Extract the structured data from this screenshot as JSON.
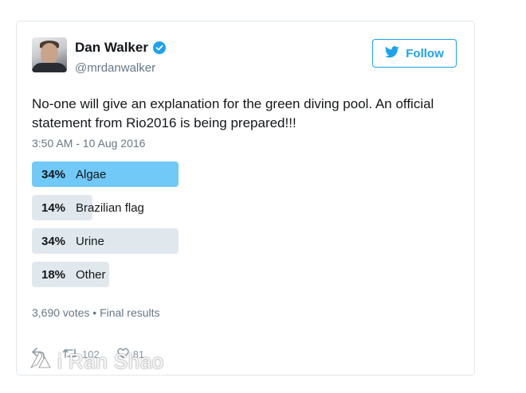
{
  "user": {
    "display_name": "Dan Walker",
    "handle": "@mrdanwalker",
    "verified": true
  },
  "follow_button": {
    "label": "Follow",
    "icon": "twitter-bird-icon"
  },
  "tweet": {
    "text": "No-one will give an explanation for the green diving pool. An official statement from Rio2016 is being prepared!!!",
    "timestamp": "3:50 AM - 10 Aug 2016"
  },
  "poll": {
    "options": [
      {
        "percent_label": "34%",
        "percent": 34,
        "label": "Algae",
        "winner": true
      },
      {
        "percent_label": "14%",
        "percent": 14,
        "label": "Brazilian flag",
        "winner": false
      },
      {
        "percent_label": "34%",
        "percent": 34,
        "label": "Urine",
        "winner": false
      },
      {
        "percent_label": "18%",
        "percent": 18,
        "label": "Other",
        "winner": false
      }
    ],
    "summary": "3,690 votes • Final results"
  },
  "actions": {
    "reply_icon": "reply-icon",
    "retweet_icon": "retweet-icon",
    "retweet_count": "102",
    "like_icon": "like-icon",
    "like_count": "81"
  },
  "watermark": {
    "text": "i Ran Shao"
  },
  "colors": {
    "accent": "#1da1f2",
    "winner_bar": "#71c9f8",
    "bar": "#e1e8ed",
    "muted": "#657786"
  }
}
